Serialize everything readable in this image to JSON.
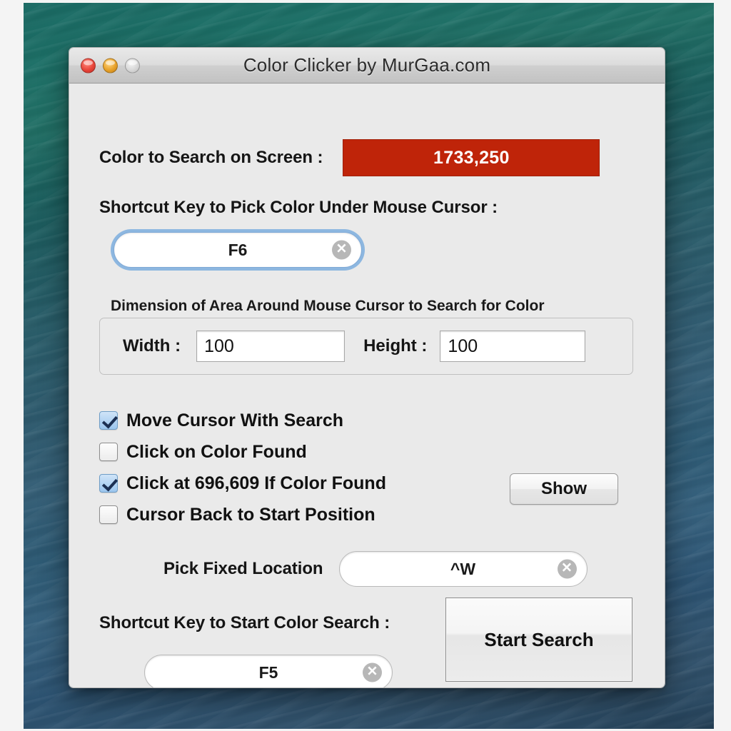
{
  "window": {
    "title": "Color Clicker by MurGaa.com",
    "traffic_lights": [
      {
        "name": "close",
        "label": "Close"
      },
      {
        "name": "minimize",
        "label": "Minimize"
      },
      {
        "name": "zoom",
        "label": "Zoom"
      }
    ]
  },
  "colors": {
    "swatch": "#bf2409",
    "panel": "#eaeaea",
    "titlebar": "#dcdcdc",
    "focus_ring": "#6ea6dc",
    "checkbox_on": "#9cc6ee"
  },
  "color_search": {
    "label": "Color to Search on Screen :",
    "swatch_text": "1733,250"
  },
  "pick_shortcut": {
    "label": "Shortcut Key to Pick Color Under Mouse Cursor :",
    "value": "F6",
    "placeholder": "",
    "clear_icon": "clear-x-icon"
  },
  "dimension": {
    "caption": "Dimension of Area Around Mouse Cursor to Search for Color",
    "width_label": "Width :",
    "width_value": "100",
    "height_label": "Height :",
    "height_value": "100"
  },
  "options": [
    {
      "label": "Move Cursor With Search",
      "checked": true
    },
    {
      "label": "Click on Color Found",
      "checked": false
    },
    {
      "label": "Click at 696,609 If Color Found",
      "checked": true
    },
    {
      "label": "Cursor Back to Start Position",
      "checked": false
    }
  ],
  "show_button": {
    "label": "Show"
  },
  "pick_fixed": {
    "label": "Pick Fixed Location",
    "value": "^W",
    "clear_icon": "clear-x-icon"
  },
  "start_shortcut": {
    "label": "Shortcut Key to Start Color Search :",
    "value": "F5",
    "clear_icon": "clear-x-icon"
  },
  "start_button": {
    "label": "Start Search"
  }
}
